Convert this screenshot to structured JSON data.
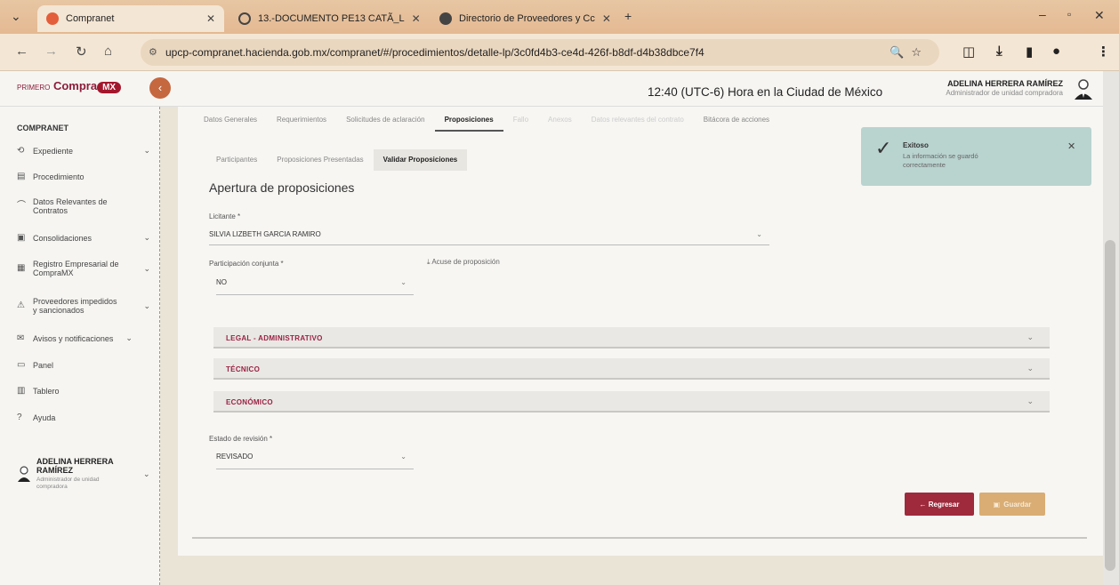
{
  "browser": {
    "tabs": [
      {
        "title": "Compranet",
        "active": true
      },
      {
        "title": "13.-DOCUMENTO PE13 CATÃ_L",
        "active": false
      },
      {
        "title": "Directorio de Proveedores y Cc",
        "active": false
      }
    ],
    "url": "upcp-compranet.hacienda.gob.mx/compranet/#/procedimientos/detalle-lp/3c0fd4b3-ce4d-426f-b8df-d4b38dbce7f4"
  },
  "header": {
    "logo_prefix": "PRIMERO",
    "logo_text": "Compra",
    "logo_pill": "MX",
    "clock": "12:40 (UTC-6) Hora en la Ciudad de México",
    "user_name": "ADELINA HERRERA RAMÍREZ",
    "user_role": "Administrador de unidad compradora"
  },
  "sidebar": {
    "title": "COMPRANET",
    "items": [
      {
        "label": "Expediente",
        "icon": "folder-icon",
        "chevron": true
      },
      {
        "label": "Procedimiento",
        "icon": "document-icon",
        "chevron": false
      },
      {
        "label": "Datos Relevantes de Contratos",
        "icon": "chart-icon",
        "chevron": false
      },
      {
        "label": "Consolidaciones",
        "icon": "layers-icon",
        "chevron": true
      },
      {
        "label": "Registro Empresarial de CompraMX",
        "icon": "building-icon",
        "chevron": true
      },
      {
        "label": "Proveedores impedidos y sancionados",
        "icon": "warning-icon",
        "chevron": true
      },
      {
        "label": "Avisos y notificaciones",
        "icon": "bell-icon",
        "chevron": true
      },
      {
        "label": "Panel",
        "icon": "panel-icon",
        "chevron": false
      },
      {
        "label": "Tablero",
        "icon": "dashboard-icon",
        "chevron": false
      },
      {
        "label": "Ayuda",
        "icon": "help-icon",
        "chevron": false
      }
    ],
    "user_name_line1": "ADELINA HERRERA",
    "user_name_line2": "RAMÍREZ",
    "user_role": "Administrador de unidad compradora"
  },
  "main": {
    "tabs": [
      {
        "label": "Datos Generales",
        "active": false
      },
      {
        "label": "Requerimientos",
        "active": false
      },
      {
        "label": "Solicitudes de aclaración",
        "active": false
      },
      {
        "label": "Proposiciones",
        "active": true
      },
      {
        "label": "Fallo",
        "active": false
      },
      {
        "label": "Anexos",
        "active": false
      },
      {
        "label": "Datos relevantes del contrato",
        "active": false
      },
      {
        "label": "Bitácora de acciones",
        "active": false
      }
    ],
    "subtabs": [
      {
        "label": "Participantes",
        "active": false
      },
      {
        "label": "Proposiciones Presentadas",
        "active": false
      },
      {
        "label": "Validar Proposiciones",
        "active": true
      }
    ],
    "section_title": "Apertura de proposiciones",
    "licitante": {
      "label": "Licitante *",
      "value": "SILVIA LIZBETH GARCIA RAMIRO"
    },
    "participacion": {
      "label": "Participación conjunta *",
      "value": "NO"
    },
    "acuse_link": "Acuse de proposición",
    "accordions": [
      {
        "label": "LEGAL - ADMINISTRATIVO"
      },
      {
        "label": "TÉCNICO"
      },
      {
        "label": "ECONÓMICO"
      }
    ],
    "estado": {
      "label": "Estado de revisión *",
      "value": "REVISADO"
    },
    "back_button": "← Regresar",
    "save_button": "Guardar"
  },
  "toast": {
    "title": "Exitoso",
    "message": "La información se guardó correctamente"
  },
  "colors": {
    "accent": "#9b2143",
    "back_button": "#9e2a3c",
    "save_button": "#d9ad74",
    "toast_bg": "#b9d3cf"
  }
}
